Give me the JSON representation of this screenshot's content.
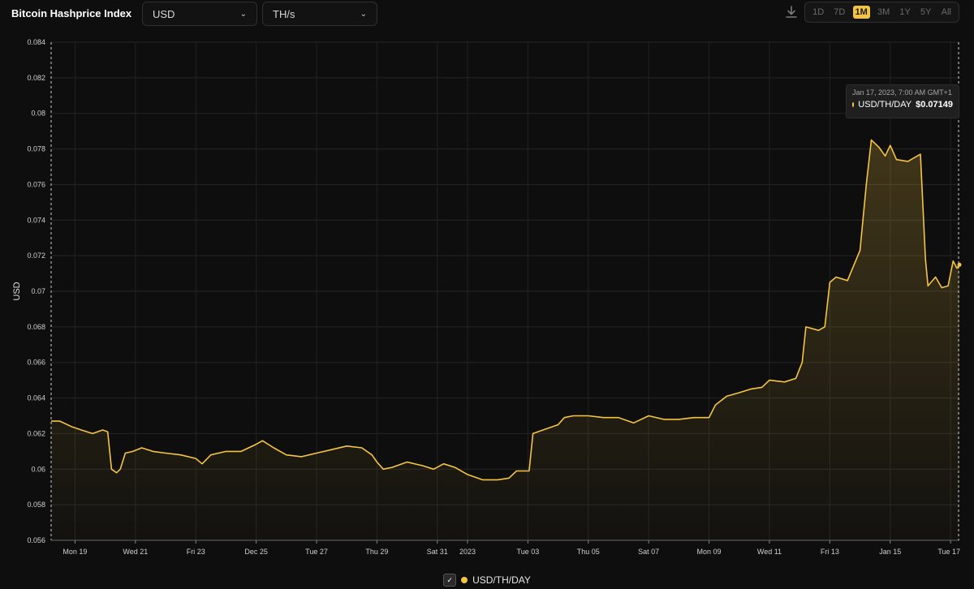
{
  "header": {
    "title": "Bitcoin Hashprice Index",
    "currency_select": "USD",
    "unit_select": "TH/s",
    "download_icon": "download-icon",
    "ranges": [
      "1D",
      "7D",
      "1M",
      "3M",
      "1Y",
      "5Y",
      "All"
    ],
    "active_range": "1M"
  },
  "tooltip": {
    "date": "Jan 17, 2023, 7:00 AM GMT+1",
    "series": "USD/TH/DAY",
    "value": "$0.07149"
  },
  "legend": {
    "label": "USD/TH/DAY"
  },
  "colors": {
    "line": "#f5c542",
    "background": "#0e0e0e",
    "grid": "#262626"
  },
  "chart_data": {
    "type": "area",
    "title": "",
    "ylabel": "USD",
    "xlabel": "",
    "ylim": [
      0.056,
      0.084
    ],
    "xlim": [
      "2022-12-18 05:00",
      "2023-01-17 07:00"
    ],
    "yticks": [
      0.056,
      0.058,
      0.06,
      0.062,
      0.064,
      0.066,
      0.068,
      0.07,
      0.072,
      0.074,
      0.076,
      0.078,
      0.08,
      0.082,
      0.084
    ],
    "ytick_labels": [
      "0.056",
      "0.058",
      "0.06",
      "0.062",
      "0.064",
      "0.066",
      "0.068",
      "0.07",
      "0.072",
      "0.074",
      "0.076",
      "0.078",
      "0.08",
      "0.082",
      "0.084"
    ],
    "xticks": [
      {
        "date": "2022-12-19",
        "label": "Mon 19"
      },
      {
        "date": "2022-12-21",
        "label": "Wed 21"
      },
      {
        "date": "2022-12-23",
        "label": "Fri 23"
      },
      {
        "date": "2022-12-25",
        "label": "Dec 25"
      },
      {
        "date": "2022-12-27",
        "label": "Tue 27"
      },
      {
        "date": "2022-12-29",
        "label": "Thu 29"
      },
      {
        "date": "2022-12-31",
        "label": "Sat 31"
      },
      {
        "date": "2023-01-01",
        "label": "2023"
      },
      {
        "date": "2023-01-03",
        "label": "Tue 03"
      },
      {
        "date": "2023-01-05",
        "label": "Thu 05"
      },
      {
        "date": "2023-01-07",
        "label": "Sat 07"
      },
      {
        "date": "2023-01-09",
        "label": "Mon 09"
      },
      {
        "date": "2023-01-11",
        "label": "Wed 11"
      },
      {
        "date": "2023-01-13",
        "label": "Fri 13"
      },
      {
        "date": "2023-01-15",
        "label": "Jan 15"
      },
      {
        "date": "2023-01-17",
        "label": "Tue 17"
      }
    ],
    "grid": true,
    "legend": "bottom-center",
    "series": [
      {
        "name": "USD/TH/DAY",
        "color": "#f5c542",
        "points": [
          [
            "2022-12-18 05:00",
            0.0627
          ],
          [
            "2022-12-18 12:00",
            0.0627
          ],
          [
            "2022-12-18 21:00",
            0.0624
          ],
          [
            "2022-12-19 05:00",
            0.0622
          ],
          [
            "2022-12-19 14:00",
            0.062
          ],
          [
            "2022-12-19 22:00",
            0.0622
          ],
          [
            "2022-12-20 02:00",
            0.0621
          ],
          [
            "2022-12-20 05:00",
            0.06
          ],
          [
            "2022-12-20 09:00",
            0.0598
          ],
          [
            "2022-12-20 12:00",
            0.06
          ],
          [
            "2022-12-20 16:00",
            0.0609
          ],
          [
            "2022-12-20 22:00",
            0.061
          ],
          [
            "2022-12-21 05:00",
            0.0612
          ],
          [
            "2022-12-21 14:00",
            0.061
          ],
          [
            "2022-12-22 00:00",
            0.0609
          ],
          [
            "2022-12-22 12:00",
            0.0608
          ],
          [
            "2022-12-23 00:00",
            0.0606
          ],
          [
            "2022-12-23 05:00",
            0.0603
          ],
          [
            "2022-12-23 12:00",
            0.0608
          ],
          [
            "2022-12-24 00:00",
            0.061
          ],
          [
            "2022-12-24 12:00",
            0.061
          ],
          [
            "2022-12-25 00:00",
            0.0614
          ],
          [
            "2022-12-25 05:00",
            0.0616
          ],
          [
            "2022-12-25 14:00",
            0.0612
          ],
          [
            "2022-12-26 00:00",
            0.0608
          ],
          [
            "2022-12-26 12:00",
            0.0607
          ],
          [
            "2022-12-27 00:00",
            0.0609
          ],
          [
            "2022-12-27 12:00",
            0.0611
          ],
          [
            "2022-12-28 00:00",
            0.0613
          ],
          [
            "2022-12-28 12:00",
            0.0612
          ],
          [
            "2022-12-28 20:00",
            0.0608
          ],
          [
            "2022-12-29 00:00",
            0.0604
          ],
          [
            "2022-12-29 05:00",
            0.06
          ],
          [
            "2022-12-29 12:00",
            0.0601
          ],
          [
            "2022-12-30 00:00",
            0.0604
          ],
          [
            "2022-12-30 12:00",
            0.0602
          ],
          [
            "2022-12-30 21:00",
            0.06
          ],
          [
            "2022-12-31 05:00",
            0.0603
          ],
          [
            "2022-12-31 14:00",
            0.0601
          ],
          [
            "2023-01-01 00:00",
            0.0597
          ],
          [
            "2023-01-01 12:00",
            0.0594
          ],
          [
            "2023-01-02 00:00",
            0.0594
          ],
          [
            "2023-01-02 09:00",
            0.0595
          ],
          [
            "2023-01-02 15:00",
            0.0599
          ],
          [
            "2023-01-02 21:00",
            0.0599
          ],
          [
            "2023-01-03 01:00",
            0.0599
          ],
          [
            "2023-01-03 04:00",
            0.062
          ],
          [
            "2023-01-03 12:00",
            0.0622
          ],
          [
            "2023-01-04 00:00",
            0.0625
          ],
          [
            "2023-01-04 05:00",
            0.0629
          ],
          [
            "2023-01-04 12:00",
            0.063
          ],
          [
            "2023-01-05 00:00",
            0.063
          ],
          [
            "2023-01-05 12:00",
            0.0629
          ],
          [
            "2023-01-06 00:00",
            0.0629
          ],
          [
            "2023-01-06 12:00",
            0.0626
          ],
          [
            "2023-01-07 00:00",
            0.063
          ],
          [
            "2023-01-07 12:00",
            0.0628
          ],
          [
            "2023-01-08 00:00",
            0.0628
          ],
          [
            "2023-01-08 12:00",
            0.0629
          ],
          [
            "2023-01-09 00:00",
            0.0629
          ],
          [
            "2023-01-09 05:00",
            0.0636
          ],
          [
            "2023-01-09 14:00",
            0.0641
          ],
          [
            "2023-01-10 00:00",
            0.0643
          ],
          [
            "2023-01-10 09:00",
            0.0645
          ],
          [
            "2023-01-10 18:00",
            0.0646
          ],
          [
            "2023-01-11 00:00",
            0.065
          ],
          [
            "2023-01-11 12:00",
            0.0649
          ],
          [
            "2023-01-11 21:00",
            0.0651
          ],
          [
            "2023-01-12 02:00",
            0.066
          ],
          [
            "2023-01-12 05:00",
            0.068
          ],
          [
            "2023-01-12 15:00",
            0.0678
          ],
          [
            "2023-01-12 20:00",
            0.068
          ],
          [
            "2023-01-13 00:00",
            0.0705
          ],
          [
            "2023-01-13 05:00",
            0.0708
          ],
          [
            "2023-01-13 14:00",
            0.0706
          ],
          [
            "2023-01-14 00:00",
            0.0723
          ],
          [
            "2023-01-14 05:00",
            0.076
          ],
          [
            "2023-01-14 09:00",
            0.0785
          ],
          [
            "2023-01-14 15:00",
            0.0781
          ],
          [
            "2023-01-14 20:00",
            0.0776
          ],
          [
            "2023-01-15 00:00",
            0.0782
          ],
          [
            "2023-01-15 05:00",
            0.0774
          ],
          [
            "2023-01-15 14:00",
            0.0773
          ],
          [
            "2023-01-16 00:00",
            0.0777
          ],
          [
            "2023-01-16 04:00",
            0.0718
          ],
          [
            "2023-01-16 06:00",
            0.0703
          ],
          [
            "2023-01-16 12:00",
            0.0708
          ],
          [
            "2023-01-16 17:00",
            0.0702
          ],
          [
            "2023-01-16 22:00",
            0.0703
          ],
          [
            "2023-01-17 02:00",
            0.0717
          ],
          [
            "2023-01-17 05:00",
            0.0713
          ],
          [
            "2023-01-17 07:00",
            0.07149
          ]
        ]
      }
    ]
  }
}
